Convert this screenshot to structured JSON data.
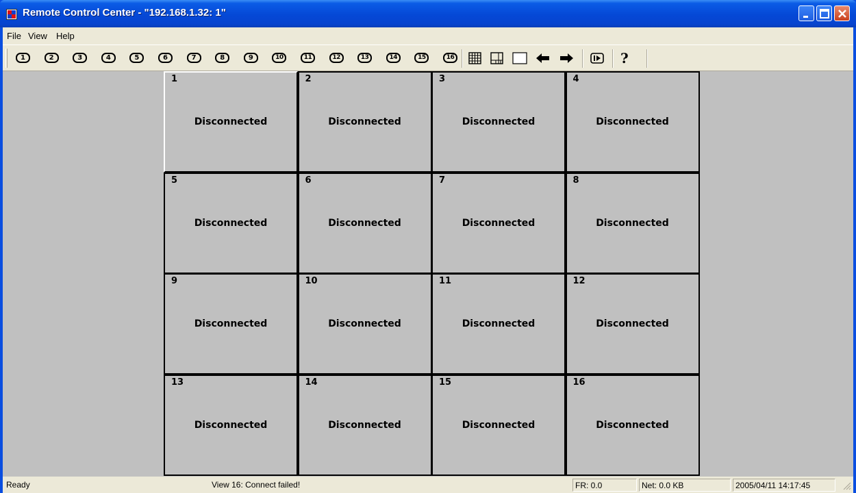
{
  "window": {
    "title": "Remote Control Center - \"192.168.1.32: 1\""
  },
  "menu": [
    "File",
    "View",
    "Help"
  ],
  "toolbar": {
    "channel_buttons": [
      "1",
      "2",
      "3",
      "4",
      "5",
      "6",
      "7",
      "8",
      "9",
      "10",
      "11",
      "12",
      "13",
      "14",
      "15",
      "16"
    ],
    "tools": [
      "grid-16-icon",
      "layout-custom-icon",
      "single-view-icon",
      "arrow-left-icon",
      "arrow-right-icon",
      "play-sequence-icon",
      "help-icon"
    ],
    "help_label": "?"
  },
  "cells": [
    {
      "num": "1",
      "status": "Disconnected"
    },
    {
      "num": "2",
      "status": "Disconnected"
    },
    {
      "num": "3",
      "status": "Disconnected"
    },
    {
      "num": "4",
      "status": "Disconnected"
    },
    {
      "num": "5",
      "status": "Disconnected"
    },
    {
      "num": "6",
      "status": "Disconnected"
    },
    {
      "num": "7",
      "status": "Disconnected"
    },
    {
      "num": "8",
      "status": "Disconnected"
    },
    {
      "num": "9",
      "status": "Disconnected"
    },
    {
      "num": "10",
      "status": "Disconnected"
    },
    {
      "num": "11",
      "status": "Disconnected"
    },
    {
      "num": "12",
      "status": "Disconnected"
    },
    {
      "num": "13",
      "status": "Disconnected"
    },
    {
      "num": "14",
      "status": "Disconnected"
    },
    {
      "num": "15",
      "status": "Disconnected"
    },
    {
      "num": "16",
      "status": "Disconnected"
    }
  ],
  "status": {
    "ready": "Ready",
    "message": "View 16: Connect failed!",
    "fr": "FR: 0.0",
    "net": "Net: 0.0 KB",
    "datetime": "2005/04/11 14:17:45"
  }
}
